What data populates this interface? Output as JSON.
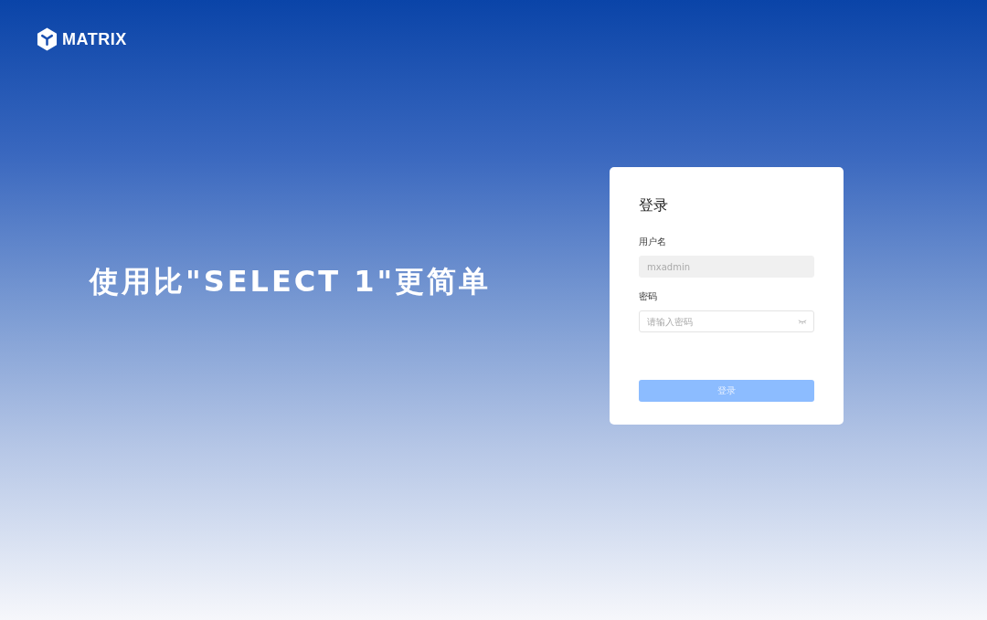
{
  "brand": {
    "name": "MATRIX"
  },
  "headline": "使用比\"SELECT 1\"更简单",
  "login": {
    "title": "登录",
    "fields": [
      {
        "label": "用户名",
        "value": "mxadmin",
        "disabled": true,
        "kind": "text"
      },
      {
        "label": "密码",
        "placeholder": "请输入密码",
        "disabled": false,
        "kind": "password"
      }
    ],
    "submit": {
      "label": "登录",
      "disabled": true
    }
  }
}
